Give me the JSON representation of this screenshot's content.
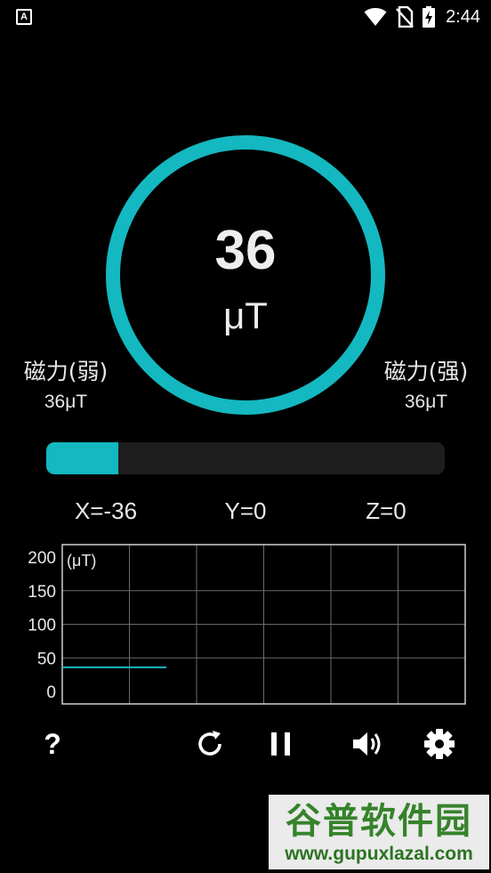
{
  "status_bar": {
    "app_icon_letter": "A",
    "time": "2:44",
    "icons": [
      "notification-a-icon",
      "wifi-icon",
      "no-sim-icon",
      "battery-charging-icon"
    ]
  },
  "gauge": {
    "value": "36",
    "unit": "μT",
    "accent_color": "#14b8c0"
  },
  "left_stat": {
    "label": "磁力(弱)",
    "value": "36μT"
  },
  "right_stat": {
    "label": "磁力(强)",
    "value": "36μT"
  },
  "progress": {
    "fraction": 0.18,
    "fill_color": "#14b8c0",
    "track_color": "#1e1e1e"
  },
  "axes": {
    "x": "X=-36",
    "y": "Y=0",
    "z": "Z=0"
  },
  "chart_data": {
    "type": "line",
    "unit_label": "(μT)",
    "y_ticks": [
      "200",
      "150",
      "100",
      "50",
      "0"
    ],
    "y_tick_values": [
      200,
      150,
      100,
      50,
      0
    ],
    "ylim": [
      0,
      200
    ],
    "x_range": [
      0,
      6
    ],
    "grid": true,
    "series": [
      {
        "x": [
          0,
          1.55
        ],
        "y": [
          36,
          36
        ],
        "color": "#14b8c0"
      }
    ]
  },
  "toolbar": {
    "help_label": "?",
    "icons": [
      "help-icon",
      "refresh-icon",
      "pause-icon",
      "volume-icon",
      "settings-icon"
    ]
  },
  "watermark": {
    "title": "谷普软件园",
    "url": "www.gupuxlazal.com"
  }
}
